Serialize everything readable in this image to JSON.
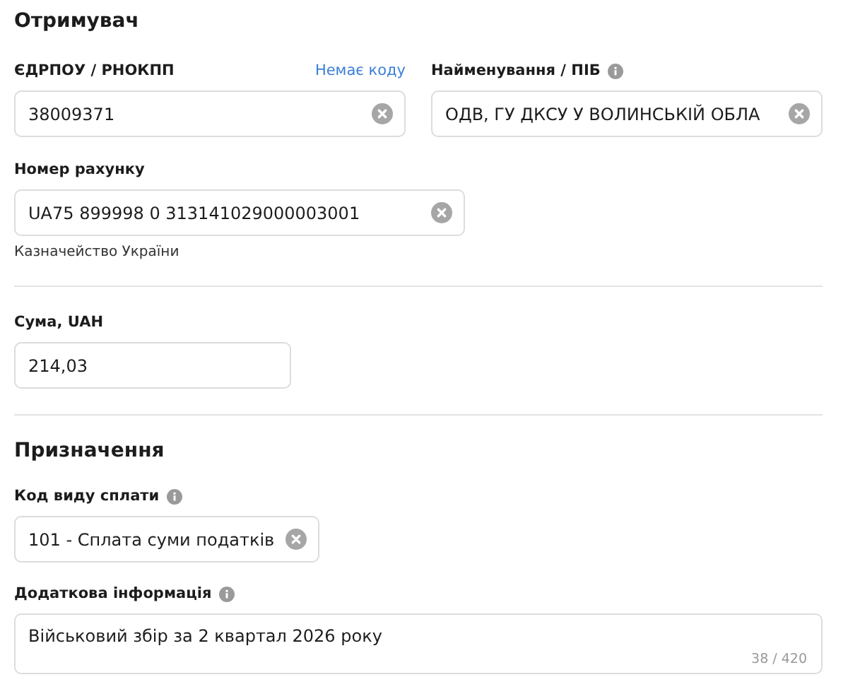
{
  "recipient": {
    "title": "Отримувач",
    "code": {
      "label": "ЄДРПОУ / РНОКПП",
      "link": "Немає коду",
      "value": "38009371",
      "clearable": true
    },
    "name": {
      "label": "Найменування / ПІБ",
      "info": true,
      "value": "ОДВ, ГУ ДКСУ У ВОЛИНСЬКІЙ ОБЛА",
      "clearable": true
    },
    "account": {
      "label": "Номер рахунку",
      "value": "UA75 899998 0 313141029000003001",
      "clearable": true,
      "note": "Казначейство України"
    }
  },
  "amount": {
    "label": "Сума, UAH",
    "value": "214,03",
    "clearable": false
  },
  "purpose": {
    "title": "Призначення",
    "payment_code": {
      "label": "Код виду сплати",
      "info": true,
      "value": "101 - Сплата суми податків",
      "clearable": true
    },
    "details": {
      "label": "Додаткова інформація",
      "info": true,
      "value": "Військовий збір за 2 квартал 2026 року",
      "counter": "38 / 420"
    }
  }
}
